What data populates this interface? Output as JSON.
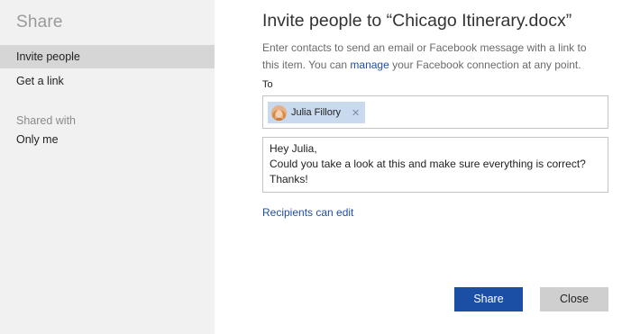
{
  "sidebar": {
    "title": "Share",
    "items": [
      {
        "label": "Invite people",
        "selected": true
      },
      {
        "label": "Get a link",
        "selected": false
      }
    ],
    "shared_with_label": "Shared with",
    "shared_with_value": "Only me"
  },
  "dialog": {
    "title": "Invite people to “Chicago Itinerary.docx”",
    "description_before": "Enter contacts to send an email or Facebook message with a link to this item. You can ",
    "description_link": "manage",
    "description_after": " your Facebook connection at any point.",
    "to_label": "To",
    "recipient": {
      "name": "Julia Fillory",
      "remove_glyph": "✕",
      "avatar_icon": "user-avatar"
    },
    "message_lines": [
      "Hey Julia,",
      "Could you take a look at this and make sure everything is correct?",
      "Thanks!"
    ],
    "recipients_link": "Recipients can edit"
  },
  "buttons": {
    "share": "Share",
    "close": "Close"
  },
  "colors": {
    "accent": "#1b4fa5",
    "link": "#1f4fa3",
    "sidebar_bg": "#f1f1f1",
    "selected_bg": "#d6d6d6",
    "chip_bg": "#c9d9ee"
  }
}
